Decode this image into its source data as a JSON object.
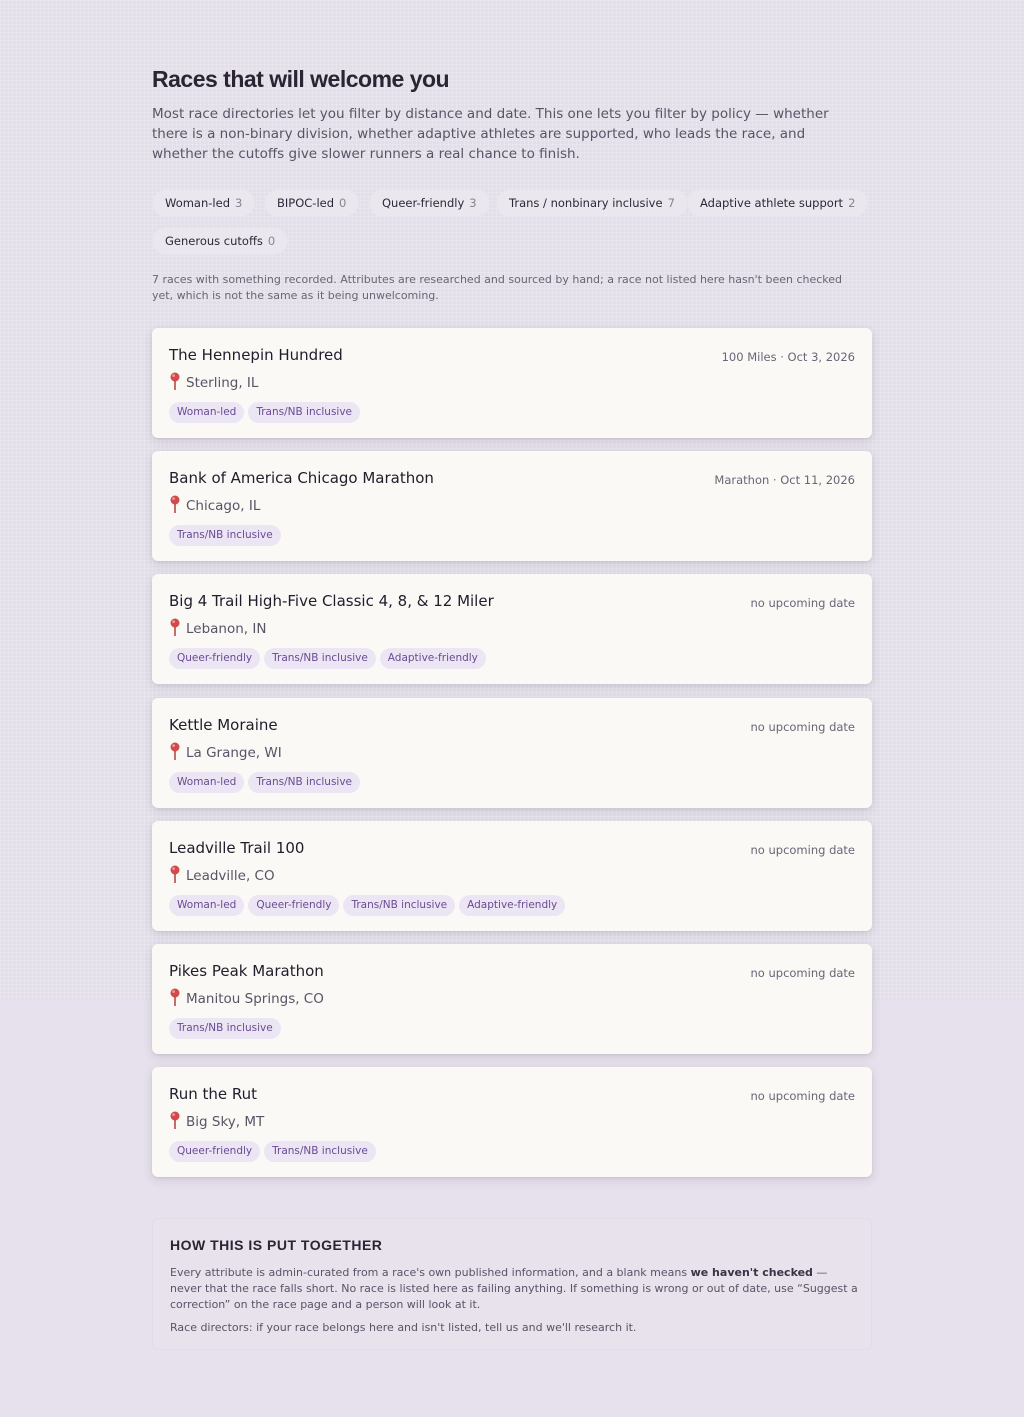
{
  "page": {
    "title": "Races that will welcome you",
    "intro": "Most race directories let you filter by distance and date. This one lets you filter by policy — whether there is a non-binary division, whether adaptive athletes are supported, who leads the race, and whether the cutoffs give slower runners a real chance to finish.",
    "count_note": "7 races with something recorded. Attributes are researched and sourced by hand; a race not listed here hasn't been checked yet, which is not the same as it being unwelcoming."
  },
  "filters": [
    {
      "label": "Woman-led",
      "count": "3"
    },
    {
      "label": "BIPOC-led",
      "count": "0"
    },
    {
      "label": "Queer-friendly",
      "count": "3"
    },
    {
      "label": "Trans / nonbinary inclusive",
      "count": "7"
    },
    {
      "label": "Adaptive athlete support",
      "count": "2"
    },
    {
      "label": "Generous cutoffs",
      "count": "0"
    }
  ],
  "races": [
    {
      "name": "The Hennepin Hundred",
      "meta": "100 Miles · Oct 3, 2026",
      "location": "Sterling, IL",
      "tags": [
        "Woman-led",
        "Trans/NB inclusive"
      ]
    },
    {
      "name": "Bank of America Chicago Marathon",
      "meta": "Marathon · Oct 11, 2026",
      "location": "Chicago, IL",
      "tags": [
        "Trans/NB inclusive"
      ]
    },
    {
      "name": "Big 4 Trail High-Five Classic 4, 8, & 12 Miler",
      "meta": "no upcoming date",
      "location": "Lebanon, IN",
      "tags": [
        "Queer-friendly",
        "Trans/NB inclusive",
        "Adaptive-friendly"
      ]
    },
    {
      "name": "Kettle Moraine",
      "meta": "no upcoming date",
      "location": "La Grange, WI",
      "tags": [
        "Woman-led",
        "Trans/NB inclusive"
      ]
    },
    {
      "name": "Leadville Trail 100",
      "meta": "no upcoming date",
      "location": "Leadville, CO",
      "tags": [
        "Woman-led",
        "Queer-friendly",
        "Trans/NB inclusive",
        "Adaptive-friendly"
      ]
    },
    {
      "name": "Pikes Peak Marathon",
      "meta": "no upcoming date",
      "location": "Manitou Springs, CO",
      "tags": [
        "Trans/NB inclusive"
      ]
    },
    {
      "name": "Run the Rut",
      "meta": "no upcoming date",
      "location": "Big Sky, MT",
      "tags": [
        "Queer-friendly",
        "Trans/NB inclusive"
      ]
    }
  ],
  "method": {
    "heading": "HOW THIS IS PUT TOGETHER",
    "p1_before": "Every attribute is admin-curated from a race's own published information, and a blank means ",
    "p1_bold": "we haven't checked",
    "p1_after": " — never that the race falls short. No race is listed here as failing anything. If something is wrong or out of date, use “Suggest a correction” on the race page and a person will look at it.",
    "p2": "Race directors: if your race belongs here and isn't listed, tell us and we'll research it."
  }
}
